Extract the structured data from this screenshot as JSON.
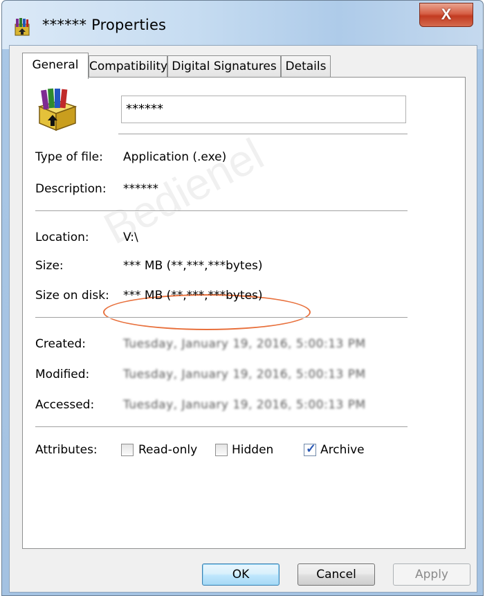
{
  "window": {
    "title": "****** Properties",
    "close_glyph": "X"
  },
  "tabs": [
    {
      "label": "General",
      "active": true
    },
    {
      "label": "Compatibility",
      "active": false
    },
    {
      "label": "Digital Signatures",
      "active": false
    },
    {
      "label": "Details",
      "active": false
    }
  ],
  "general": {
    "file_name": "******",
    "type_of_file": {
      "label": "Type of file:",
      "value": "Application (.exe)"
    },
    "description": {
      "label": "Description:",
      "value": "******"
    },
    "location": {
      "label": "Location:",
      "value": "V:\\"
    },
    "size": {
      "label": "Size:",
      "value": "*** MB (**,***,***bytes)"
    },
    "size_on_disk": {
      "label": "Size on disk:",
      "value": "*** MB (**,***,***bytes)"
    },
    "created": {
      "label": "Created:",
      "value": "Tuesday, January 19, 2016, 5:00:13 PM"
    },
    "modified": {
      "label": "Modified:",
      "value": "Tuesday, January 19, 2016, 5:00:13 PM"
    },
    "accessed": {
      "label": "Accessed:",
      "value": "Tuesday, January 19, 2016, 5:00:13 PM"
    },
    "attributes": {
      "label": "Attributes:",
      "read_only": {
        "label": "Read-only",
        "checked": false
      },
      "hidden": {
        "label": "Hidden",
        "checked": false
      },
      "archive": {
        "label": "Archive",
        "checked": true
      }
    }
  },
  "buttons": {
    "ok": "OK",
    "cancel": "Cancel",
    "apply": "Apply"
  },
  "watermark": "Bedienel",
  "colors": {
    "highlight_ellipse": "#e8703c",
    "close_button": "#c23b21",
    "default_button_border": "#3c7fb1"
  }
}
